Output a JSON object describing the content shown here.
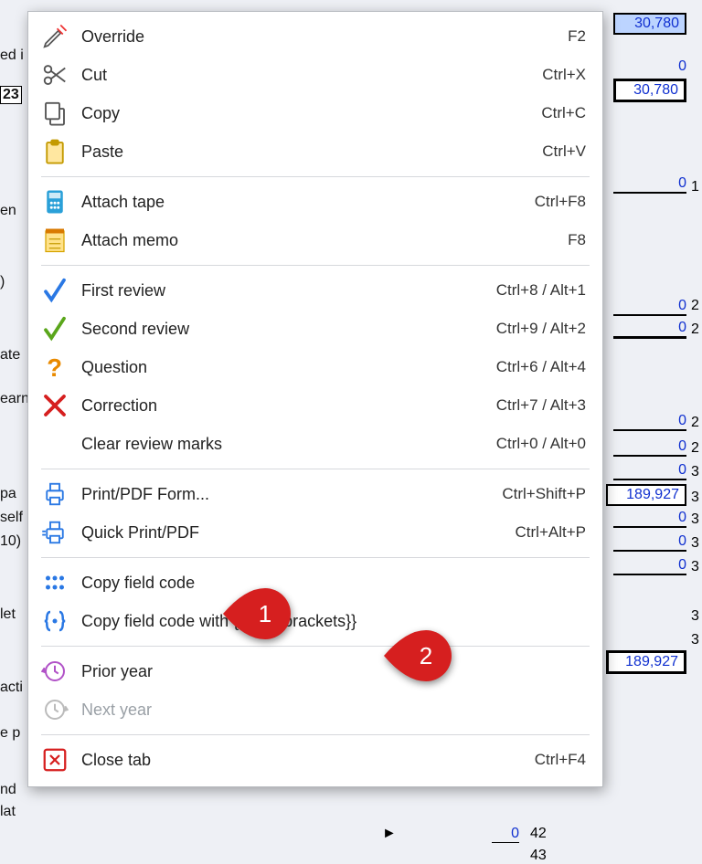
{
  "background": {
    "labels": {
      "r0": "ed i",
      "r1": "23",
      "r2": "en",
      "r3": ")",
      "r4": "ate",
      "r5": "earn",
      "r6": "pa",
      "r7": "self",
      "r8": "10)",
      "r9": "let",
      "r10": "acti",
      "r11": "e p",
      "r12": "nd",
      "r13": "lat"
    },
    "values": {
      "v1": "30,780",
      "v2": "0",
      "v3": "30,780",
      "v4": "0",
      "v5": "0",
      "v6": "0",
      "v7": "0",
      "v8": "0",
      "v9": "0",
      "v10": "189,927",
      "v11": "0",
      "v12": "0",
      "v13": "0",
      "v14": "189,927",
      "v24": "2",
      "v25": "2",
      "v26": "2",
      "v27": "2",
      "v28": "3",
      "v29": "3",
      "v30": "3",
      "v31": "3",
      "v32": "3",
      "v33": "3",
      "v34": "3"
    },
    "bottom": {
      "c1": "0",
      "l1": "42",
      "c2": "",
      "l2": "43"
    }
  },
  "menu": {
    "override": {
      "label": "Override",
      "shortcut": "F2"
    },
    "cut": {
      "label": "Cut",
      "shortcut": "Ctrl+X"
    },
    "copy": {
      "label": "Copy",
      "shortcut": "Ctrl+C"
    },
    "paste": {
      "label": "Paste",
      "shortcut": "Ctrl+V"
    },
    "attach_tape": {
      "label": "Attach tape",
      "shortcut": "Ctrl+F8"
    },
    "attach_memo": {
      "label": "Attach memo",
      "shortcut": "F8"
    },
    "first_review": {
      "label": "First review",
      "shortcut": "Ctrl+8 / Alt+1"
    },
    "second_review": {
      "label": "Second review",
      "shortcut": "Ctrl+9 / Alt+2"
    },
    "question": {
      "label": "Question",
      "shortcut": "Ctrl+6 / Alt+4"
    },
    "correction": {
      "label": "Correction",
      "shortcut": "Ctrl+7 / Alt+3"
    },
    "clear_review": {
      "label": "Clear review marks",
      "shortcut": "Ctrl+0 / Alt+0"
    },
    "print_pdf": {
      "label": "Print/PDF Form...",
      "shortcut": "Ctrl+Shift+P"
    },
    "quick_print": {
      "label": "Quick Print/PDF",
      "shortcut": "Ctrl+Alt+P"
    },
    "copy_field": {
      "label": "Copy field code",
      "shortcut": ""
    },
    "copy_field_curly": {
      "label": "Copy field code with {{curly brackets}}",
      "shortcut": ""
    },
    "prior_year": {
      "label": "Prior year",
      "shortcut": ""
    },
    "next_year": {
      "label": "Next year",
      "shortcut": ""
    },
    "close_tab": {
      "label": "Close tab",
      "shortcut": "Ctrl+F4"
    }
  },
  "callouts": {
    "one": "1",
    "two": "2"
  }
}
